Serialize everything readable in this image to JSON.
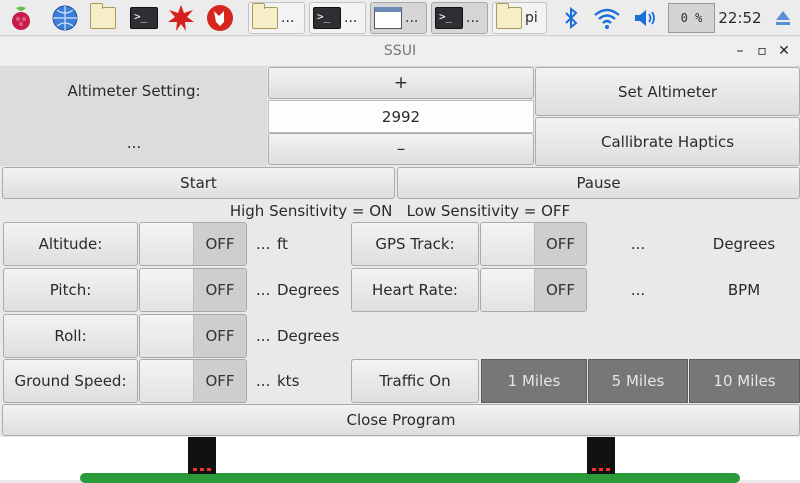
{
  "taskbar": {
    "tasks": [
      {
        "icon": "folder-icon",
        "label": "..."
      },
      {
        "icon": "terminal-icon",
        "label": "..."
      },
      {
        "icon": "window-icon",
        "label": "..."
      },
      {
        "icon": "terminal-icon",
        "label": "..."
      },
      {
        "icon": "folder-icon",
        "label": "pi"
      }
    ],
    "cpu": "0 %",
    "clock": "22:52"
  },
  "window": {
    "title": "SSUI"
  },
  "altimeter": {
    "label": "Altimeter Setting:",
    "status": "...",
    "plus": "+",
    "value": "2992",
    "minus": "–",
    "set_button": "Set Altimeter",
    "calibrate_button": "Callibrate Haptics"
  },
  "controls": {
    "start": "Start",
    "pause": "Pause"
  },
  "sensitivity": "High Sensitivity = ON   Low Sensitivity = OFF",
  "rows": [
    {
      "label": "Altitude:",
      "state": "OFF",
      "value": "...",
      "unit": "ft"
    },
    {
      "label": "Pitch:",
      "state": "OFF",
      "value": "...",
      "unit": "Degrees"
    },
    {
      "label": "Roll:",
      "state": "OFF",
      "value": "...",
      "unit": "Degrees"
    },
    {
      "label": "Ground Speed:",
      "state": "OFF",
      "value": "...",
      "unit": "kts"
    }
  ],
  "right_rows": [
    {
      "label": "GPS Track:",
      "state": "OFF",
      "value": "...",
      "unit": "Degrees"
    },
    {
      "label": "Heart Rate:",
      "state": "OFF",
      "value": "...",
      "unit": "BPM"
    }
  ],
  "traffic": {
    "label": "Traffic On",
    "ranges": [
      "1 Miles",
      "5 Miles",
      "10 Miles"
    ]
  },
  "close": "Close Program",
  "colors": {
    "range_button": "#777777",
    "horizon_green": "#2a9a3a"
  }
}
